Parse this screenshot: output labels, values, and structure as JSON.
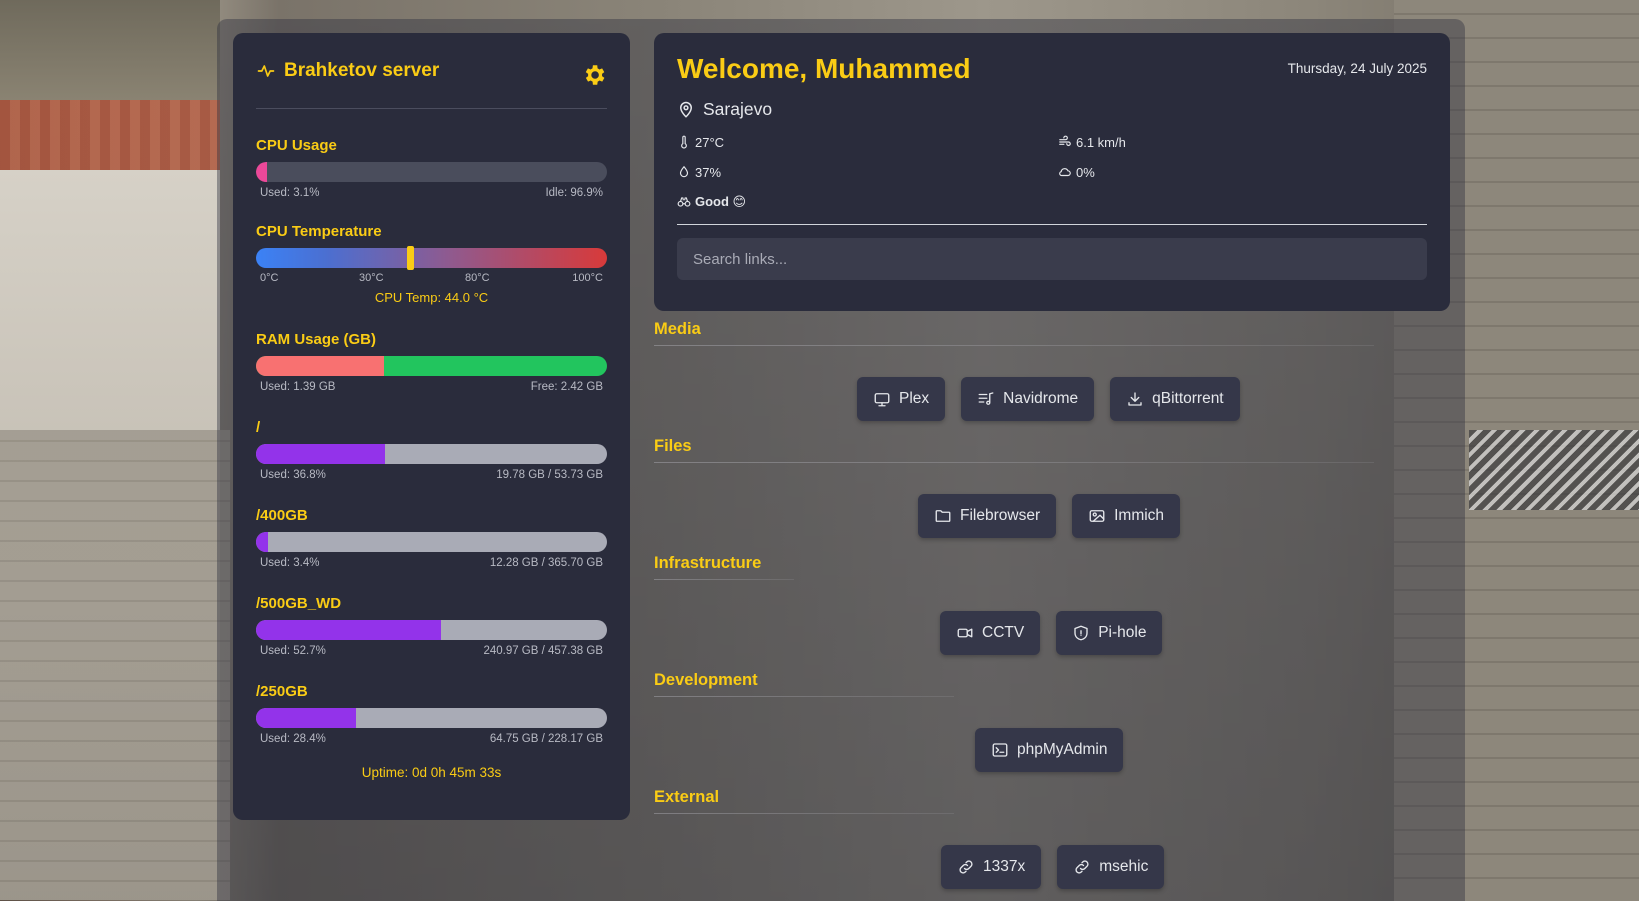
{
  "colors": {
    "accent": "#facc15",
    "panel": "#2a2c3c",
    "link_bg": "#353749"
  },
  "server": {
    "title": "Brahketov server",
    "cpu": {
      "label": "CPU Usage",
      "used": "Used: 3.1%",
      "idle": "Idle: 96.9%",
      "used_fraction": 0.031,
      "color": "#ec4899"
    },
    "temp": {
      "label": "CPU Temperature",
      "ticks": [
        "0°C",
        "30°C",
        "80°C",
        "100°C"
      ],
      "reading": "CPU Temp: 44.0 °C",
      "value_c": 44.0
    },
    "ram": {
      "label": "RAM Usage (GB)",
      "used": "Used: 1.39 GB",
      "free": "Free: 2.42 GB",
      "used_fraction": 0.365,
      "used_color": "#f87171",
      "free_color": "#22c55e"
    },
    "disks": [
      {
        "label": "/",
        "used": "Used: 36.8%",
        "size": "19.78 GB / 53.73 GB",
        "used_fraction": 0.368
      },
      {
        "label": "/400GB",
        "used": "Used: 3.4%",
        "size": "12.28 GB / 365.70 GB",
        "used_fraction": 0.034
      },
      {
        "label": "/500GB_WD",
        "used": "Used: 52.7%",
        "size": "240.97 GB / 457.38 GB",
        "used_fraction": 0.527
      },
      {
        "label": "/250GB",
        "used": "Used: 28.4%",
        "size": "64.75 GB / 228.17 GB",
        "used_fraction": 0.284
      }
    ],
    "disk_color": "#9333ea",
    "uptime": "Uptime: 0d 0h 45m 33s"
  },
  "welcome": {
    "title": "Welcome, Muhammed",
    "date": "Thursday, 24 July 2025",
    "location": "Sarajevo",
    "temperature": "27°C",
    "wind": "6.1 km/h",
    "humidity": "37%",
    "precip": "0%",
    "air_quality": "Good 😊",
    "search_placeholder": "Search links..."
  },
  "sections": [
    {
      "title": "Media",
      "links": [
        {
          "label": "Plex",
          "icon": "tv-icon"
        },
        {
          "label": "Navidrome",
          "icon": "music-list-icon"
        },
        {
          "label": "qBittorrent",
          "icon": "download-icon"
        }
      ]
    },
    {
      "title": "Files",
      "links": [
        {
          "label": "Filebrowser",
          "icon": "folder-icon"
        },
        {
          "label": "Immich",
          "icon": "image-icon"
        }
      ]
    },
    {
      "title": "Infrastructure",
      "links": [
        {
          "label": "CCTV",
          "icon": "video-camera-icon"
        },
        {
          "label": "Pi-hole",
          "icon": "shield-icon"
        }
      ]
    },
    {
      "title": "Development",
      "links": [
        {
          "label": "phpMyAdmin",
          "icon": "terminal-icon"
        }
      ]
    },
    {
      "title": "External",
      "links": [
        {
          "label": "1337x",
          "icon": "link-icon"
        },
        {
          "label": "msehic",
          "icon": "link-icon"
        }
      ]
    }
  ]
}
